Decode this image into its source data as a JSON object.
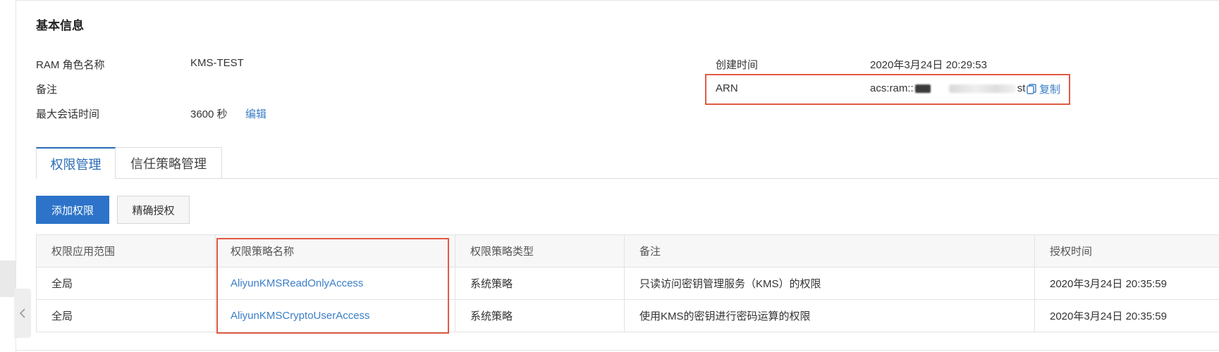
{
  "section": {
    "title": "基本信息"
  },
  "info_left": [
    {
      "label": "RAM 角色名称",
      "value": "KMS-TEST"
    },
    {
      "label": "备注",
      "value": ""
    },
    {
      "label": "最大会话时间",
      "value": "3600 秒"
    }
  ],
  "edit_label": "编辑",
  "info_right": {
    "created_label": "创建时间",
    "created_value": "2020年3月24日 20:29:53",
    "arn_label": "ARN",
    "arn_prefix": "acs:ram::",
    "arn_mid": "role/",
    "arn_suffix": "st",
    "copy_label": "复制"
  },
  "tabs": [
    {
      "label": "权限管理",
      "active": true
    },
    {
      "label": "信任策略管理",
      "active": false
    }
  ],
  "buttons": {
    "add": "添加权限",
    "precise": "精确授权"
  },
  "table": {
    "headers": [
      "权限应用范围",
      "权限策略名称",
      "权限策略类型",
      "备注",
      "授权时间"
    ],
    "rows": [
      [
        "全局",
        "AliyunKMSReadOnlyAccess",
        "系统策略",
        "只读访问密钥管理服务（KMS）的权限",
        "2020年3月24日 20:35:59"
      ],
      [
        "全局",
        "AliyunKMSCryptoUserAccess",
        "系统策略",
        "使用KMS的密钥进行密码运算的权限",
        "2020年3月24日 20:35:59"
      ]
    ]
  },
  "colors": {
    "accent": "#2c73c9",
    "link": "#3b7ec7",
    "highlight": "#e05a44"
  },
  "icons": {
    "copy": "copy-icon",
    "collapse": "chevron-left-icon"
  }
}
